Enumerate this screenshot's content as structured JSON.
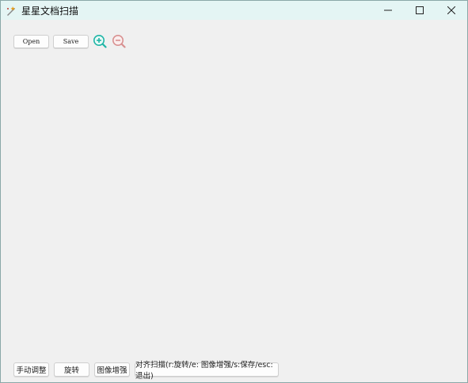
{
  "window": {
    "title": "星星文档扫描"
  },
  "toolbar": {
    "open_label": "Open",
    "save_label": "Save",
    "zoom_in_icon": "zoom-in-icon",
    "zoom_out_icon": "zoom-out-icon"
  },
  "bottom": {
    "manual_adjust_label": "手动调整",
    "rotate_label": "旋转",
    "enhance_label": "图像增强",
    "align_scan_label": "对齐扫描(r:旋转/e: 图像增强/s:保存/esc:退出)"
  },
  "colors": {
    "titlebar_bg": "#e4f5f4",
    "window_bg": "#f0f0f0",
    "zoom_in": "#1fb5a6",
    "zoom_out": "#d89090"
  }
}
